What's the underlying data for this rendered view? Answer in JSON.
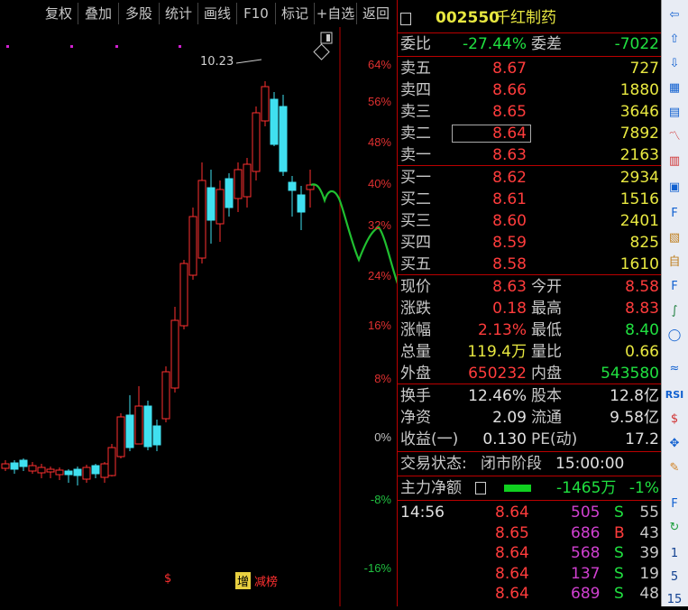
{
  "toolbar": {
    "buttons": [
      "复权",
      "叠加",
      "多股",
      "统计",
      "画线",
      "F10",
      "标记",
      "+自选",
      "返回"
    ]
  },
  "chart": {
    "pct_labels": [
      "64%",
      "56%",
      "48%",
      "40%",
      "32%",
      "24%",
      "16%",
      "8%",
      "0%",
      "-8%",
      "-16%"
    ],
    "high_label": "10.23",
    "bottom_markers": [
      "$",
      "增",
      "减榜"
    ]
  },
  "quote": {
    "code": "002550",
    "name": "千红制药",
    "weibi_label": "委比",
    "weibi_value": "-27.44%",
    "weicha_label": "委差",
    "weicha_value": "-7022",
    "asks": [
      {
        "label": "卖五",
        "price": "8.67",
        "vol": "727"
      },
      {
        "label": "卖四",
        "price": "8.66",
        "vol": "1880"
      },
      {
        "label": "卖三",
        "price": "8.65",
        "vol": "3646"
      },
      {
        "label": "卖二",
        "price": "8.64",
        "vol": "7892"
      },
      {
        "label": "卖一",
        "price": "8.63",
        "vol": "2163"
      }
    ],
    "bids": [
      {
        "label": "买一",
        "price": "8.62",
        "vol": "2934"
      },
      {
        "label": "买二",
        "price": "8.61",
        "vol": "1516"
      },
      {
        "label": "买三",
        "price": "8.60",
        "vol": "2401"
      },
      {
        "label": "买四",
        "price": "8.59",
        "vol": "825"
      },
      {
        "label": "买五",
        "price": "8.58",
        "vol": "1610"
      }
    ],
    "stats": [
      {
        "l1": "现价",
        "v1": "8.63",
        "l2": "今开",
        "v2": "8.58"
      },
      {
        "l1": "涨跌",
        "v1": "0.18",
        "l2": "最高",
        "v2": "8.83"
      },
      {
        "l1": "涨幅",
        "v1": "2.13%",
        "l2": "最低",
        "v2": "8.40"
      },
      {
        "l1": "总量",
        "v1": "119.4万",
        "l2": "量比",
        "v2": "0.66"
      },
      {
        "l1": "外盘",
        "v1": "650232",
        "l2": "内盘",
        "v2": "543580"
      }
    ],
    "fund": [
      {
        "l1": "换手",
        "v1": "12.46%",
        "l2": "股本",
        "v2": "12.8亿"
      },
      {
        "l1": "净资",
        "v1": "2.09",
        "l2": "流通",
        "v2": "9.58亿"
      },
      {
        "l1": "收益(一)",
        "v1": "0.130",
        "l2": "PE(动)",
        "v2": "17.2"
      }
    ],
    "trade_status_label": "交易状态:",
    "trade_status_value": "闭市阶段",
    "trade_time": "15:00:00",
    "main_net_label": "主力净额",
    "main_net_value": "-1465万",
    "main_net_pct": "-1%",
    "ticks": [
      {
        "time": "14:56",
        "price": "8.64",
        "vol": "505",
        "side": "S",
        "num": "55"
      },
      {
        "time": "",
        "price": "8.65",
        "vol": "686",
        "side": "B",
        "num": "43"
      },
      {
        "time": "",
        "price": "8.64",
        "vol": "568",
        "side": "S",
        "num": "39"
      },
      {
        "time": "",
        "price": "8.64",
        "vol": "137",
        "side": "S",
        "num": "19"
      },
      {
        "time": "",
        "price": "8.64",
        "vol": "689",
        "side": "S",
        "num": "48"
      }
    ]
  },
  "strip": {
    "labels": [
      "1",
      "5",
      "15"
    ]
  }
}
